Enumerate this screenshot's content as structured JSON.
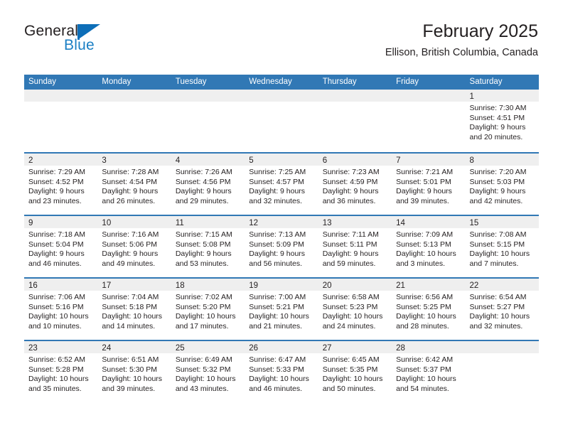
{
  "brand": {
    "name_top": "General",
    "name_bottom": "Blue",
    "accent_color": "#1b7fc4",
    "mark_icon": "triangle-flag-icon"
  },
  "header": {
    "title": "February 2025",
    "subtitle": "Ellison, British Columbia, Canada"
  },
  "theme": {
    "header_blue": "#3178b5",
    "band_gray": "#efefef",
    "text": "#231f20"
  },
  "calendar": {
    "weekdays": [
      "Sunday",
      "Monday",
      "Tuesday",
      "Wednesday",
      "Thursday",
      "Friday",
      "Saturday"
    ],
    "weeks": [
      [
        {
          "day": "",
          "lines": []
        },
        {
          "day": "",
          "lines": []
        },
        {
          "day": "",
          "lines": []
        },
        {
          "day": "",
          "lines": []
        },
        {
          "day": "",
          "lines": []
        },
        {
          "day": "",
          "lines": []
        },
        {
          "day": "1",
          "lines": [
            "Sunrise: 7:30 AM",
            "Sunset: 4:51 PM",
            "Daylight: 9 hours",
            "and 20 minutes."
          ]
        }
      ],
      [
        {
          "day": "2",
          "lines": [
            "Sunrise: 7:29 AM",
            "Sunset: 4:52 PM",
            "Daylight: 9 hours",
            "and 23 minutes."
          ]
        },
        {
          "day": "3",
          "lines": [
            "Sunrise: 7:28 AM",
            "Sunset: 4:54 PM",
            "Daylight: 9 hours",
            "and 26 minutes."
          ]
        },
        {
          "day": "4",
          "lines": [
            "Sunrise: 7:26 AM",
            "Sunset: 4:56 PM",
            "Daylight: 9 hours",
            "and 29 minutes."
          ]
        },
        {
          "day": "5",
          "lines": [
            "Sunrise: 7:25 AM",
            "Sunset: 4:57 PM",
            "Daylight: 9 hours",
            "and 32 minutes."
          ]
        },
        {
          "day": "6",
          "lines": [
            "Sunrise: 7:23 AM",
            "Sunset: 4:59 PM",
            "Daylight: 9 hours",
            "and 36 minutes."
          ]
        },
        {
          "day": "7",
          "lines": [
            "Sunrise: 7:21 AM",
            "Sunset: 5:01 PM",
            "Daylight: 9 hours",
            "and 39 minutes."
          ]
        },
        {
          "day": "8",
          "lines": [
            "Sunrise: 7:20 AM",
            "Sunset: 5:03 PM",
            "Daylight: 9 hours",
            "and 42 minutes."
          ]
        }
      ],
      [
        {
          "day": "9",
          "lines": [
            "Sunrise: 7:18 AM",
            "Sunset: 5:04 PM",
            "Daylight: 9 hours",
            "and 46 minutes."
          ]
        },
        {
          "day": "10",
          "lines": [
            "Sunrise: 7:16 AM",
            "Sunset: 5:06 PM",
            "Daylight: 9 hours",
            "and 49 minutes."
          ]
        },
        {
          "day": "11",
          "lines": [
            "Sunrise: 7:15 AM",
            "Sunset: 5:08 PM",
            "Daylight: 9 hours",
            "and 53 minutes."
          ]
        },
        {
          "day": "12",
          "lines": [
            "Sunrise: 7:13 AM",
            "Sunset: 5:09 PM",
            "Daylight: 9 hours",
            "and 56 minutes."
          ]
        },
        {
          "day": "13",
          "lines": [
            "Sunrise: 7:11 AM",
            "Sunset: 5:11 PM",
            "Daylight: 9 hours",
            "and 59 minutes."
          ]
        },
        {
          "day": "14",
          "lines": [
            "Sunrise: 7:09 AM",
            "Sunset: 5:13 PM",
            "Daylight: 10 hours",
            "and 3 minutes."
          ]
        },
        {
          "day": "15",
          "lines": [
            "Sunrise: 7:08 AM",
            "Sunset: 5:15 PM",
            "Daylight: 10 hours",
            "and 7 minutes."
          ]
        }
      ],
      [
        {
          "day": "16",
          "lines": [
            "Sunrise: 7:06 AM",
            "Sunset: 5:16 PM",
            "Daylight: 10 hours",
            "and 10 minutes."
          ]
        },
        {
          "day": "17",
          "lines": [
            "Sunrise: 7:04 AM",
            "Sunset: 5:18 PM",
            "Daylight: 10 hours",
            "and 14 minutes."
          ]
        },
        {
          "day": "18",
          "lines": [
            "Sunrise: 7:02 AM",
            "Sunset: 5:20 PM",
            "Daylight: 10 hours",
            "and 17 minutes."
          ]
        },
        {
          "day": "19",
          "lines": [
            "Sunrise: 7:00 AM",
            "Sunset: 5:21 PM",
            "Daylight: 10 hours",
            "and 21 minutes."
          ]
        },
        {
          "day": "20",
          "lines": [
            "Sunrise: 6:58 AM",
            "Sunset: 5:23 PM",
            "Daylight: 10 hours",
            "and 24 minutes."
          ]
        },
        {
          "day": "21",
          "lines": [
            "Sunrise: 6:56 AM",
            "Sunset: 5:25 PM",
            "Daylight: 10 hours",
            "and 28 minutes."
          ]
        },
        {
          "day": "22",
          "lines": [
            "Sunrise: 6:54 AM",
            "Sunset: 5:27 PM",
            "Daylight: 10 hours",
            "and 32 minutes."
          ]
        }
      ],
      [
        {
          "day": "23",
          "lines": [
            "Sunrise: 6:52 AM",
            "Sunset: 5:28 PM",
            "Daylight: 10 hours",
            "and 35 minutes."
          ]
        },
        {
          "day": "24",
          "lines": [
            "Sunrise: 6:51 AM",
            "Sunset: 5:30 PM",
            "Daylight: 10 hours",
            "and 39 minutes."
          ]
        },
        {
          "day": "25",
          "lines": [
            "Sunrise: 6:49 AM",
            "Sunset: 5:32 PM",
            "Daylight: 10 hours",
            "and 43 minutes."
          ]
        },
        {
          "day": "26",
          "lines": [
            "Sunrise: 6:47 AM",
            "Sunset: 5:33 PM",
            "Daylight: 10 hours",
            "and 46 minutes."
          ]
        },
        {
          "day": "27",
          "lines": [
            "Sunrise: 6:45 AM",
            "Sunset: 5:35 PM",
            "Daylight: 10 hours",
            "and 50 minutes."
          ]
        },
        {
          "day": "28",
          "lines": [
            "Sunrise: 6:42 AM",
            "Sunset: 5:37 PM",
            "Daylight: 10 hours",
            "and 54 minutes."
          ]
        },
        {
          "day": "",
          "lines": []
        }
      ]
    ]
  }
}
